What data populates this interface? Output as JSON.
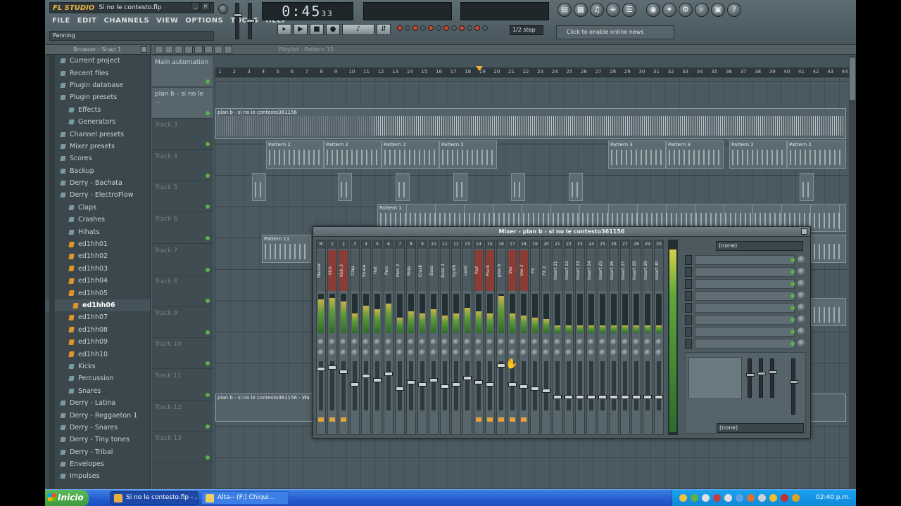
{
  "app": {
    "logo": "FL STUDIO",
    "window_title": "Si no le contesto.flp",
    "hint": "Panning",
    "time_display": "0:45",
    "time_ms": "33",
    "snap": "1/2 step",
    "news_text": "Click to enable online news",
    "menu": [
      "FILE",
      "EDIT",
      "CHANNELS",
      "VIEW",
      "OPTIONS",
      "TOOLS",
      "HELP"
    ]
  },
  "browser": {
    "title": "Browser - Snap 1",
    "items": [
      {
        "label": "Current project",
        "type": "folder",
        "level": 0
      },
      {
        "label": "Recent files",
        "type": "folder",
        "level": 0
      },
      {
        "label": "Plugin database",
        "type": "folder",
        "level": 0
      },
      {
        "label": "Plugin presets",
        "type": "folder",
        "level": 0
      },
      {
        "label": "Effects",
        "type": "folder",
        "level": 1
      },
      {
        "label": "Generators",
        "type": "folder",
        "level": 1
      },
      {
        "label": "Channel presets",
        "type": "folder",
        "level": 0
      },
      {
        "label": "Mixer presets",
        "type": "folder",
        "level": 0
      },
      {
        "label": "Scores",
        "type": "folder",
        "level": 0
      },
      {
        "label": "Backup",
        "type": "folder",
        "level": 0
      },
      {
        "label": "Derry - Bachata",
        "type": "folder",
        "level": 0
      },
      {
        "label": "Derry - ElectroFlow",
        "type": "folder",
        "level": 0
      },
      {
        "label": "Claps",
        "type": "folder",
        "level": 1
      },
      {
        "label": "Crashes",
        "type": "folder",
        "level": 1
      },
      {
        "label": "Hihats",
        "type": "folder",
        "level": 1
      },
      {
        "label": "ed1hh01",
        "type": "file",
        "level": 2
      },
      {
        "label": "ed1hh02",
        "type": "file",
        "level": 2
      },
      {
        "label": "ed1hh03",
        "type": "file",
        "level": 2
      },
      {
        "label": "ed1hh04",
        "type": "file",
        "level": 2
      },
      {
        "label": "ed1hh05",
        "type": "file",
        "level": 2
      },
      {
        "label": "ed1hh06",
        "type": "file",
        "level": 2,
        "selected": true
      },
      {
        "label": "ed1hh07",
        "type": "file",
        "level": 2
      },
      {
        "label": "ed1hh08",
        "type": "file",
        "level": 2
      },
      {
        "label": "ed1hh09",
        "type": "file",
        "level": 2
      },
      {
        "label": "ed1hh10",
        "type": "file",
        "level": 2
      },
      {
        "label": "Kicks",
        "type": "folder",
        "level": 1
      },
      {
        "label": "Percussion",
        "type": "folder",
        "level": 1
      },
      {
        "label": "Snares",
        "type": "folder",
        "level": 1
      },
      {
        "label": "Derry - Latina",
        "type": "folder",
        "level": 0
      },
      {
        "label": "Derry - Reggaeton 1",
        "type": "folder",
        "level": 0
      },
      {
        "label": "Derry - Snares",
        "type": "folder",
        "level": 0
      },
      {
        "label": "Derry - Tiny tones",
        "type": "folder",
        "level": 0
      },
      {
        "label": "Derry - Tribal",
        "type": "folder",
        "level": 0
      },
      {
        "label": "Envelopes",
        "type": "folder",
        "level": 0
      },
      {
        "label": "Impulses",
        "type": "folder",
        "level": 0
      }
    ]
  },
  "playlist": {
    "title": "Playlist - Pattern 15",
    "tracks": [
      "Main automation",
      "plan b - si no le ...",
      "Track 3",
      "Track 4",
      "Track 5",
      "Track 6",
      "Track 7",
      "Track 8",
      "Track 9",
      "Track 10",
      "Track 11",
      "Track 12",
      "Track 13"
    ],
    "ruler": [
      "1",
      "2",
      "3",
      "4",
      "5",
      "6",
      "7",
      "8",
      "9",
      "10",
      "11",
      "12",
      "13",
      "14",
      "15",
      "16",
      "17",
      "18",
      "19",
      "20",
      "21",
      "22",
      "23",
      "24",
      "25",
      "26",
      "27",
      "28",
      "29",
      "30",
      "31",
      "32",
      "33",
      "34",
      "35",
      "36",
      "37",
      "38",
      "39",
      "40",
      "41",
      "42",
      "43",
      "44"
    ],
    "audio_clip_label": "plan b - si no le contesto361156",
    "pattern_labels": [
      "Pattern 2",
      "Pattern 3",
      "Pattern 11",
      "Pattern 1"
    ],
    "bottom_clip_label": "plan b - si no le contesto361156 - Wa"
  },
  "mixer": {
    "title": "Mixer - plan b - si no le contesto361156",
    "strips": [
      {
        "num": "M",
        "label": "Master",
        "red": false,
        "level": 0.86
      },
      {
        "num": "1",
        "label": "Kick",
        "red": true,
        "level": 0.9
      },
      {
        "num": "2",
        "label": "Kick 2",
        "red": true,
        "level": 0.8
      },
      {
        "num": "3",
        "label": "Clap",
        "red": false,
        "level": 0.5
      },
      {
        "num": "4",
        "label": "Snare",
        "red": false,
        "level": 0.7
      },
      {
        "num": "5",
        "label": "Hat",
        "red": false,
        "level": 0.6
      },
      {
        "num": "6",
        "label": "Perc",
        "red": false,
        "level": 0.75
      },
      {
        "num": "7",
        "label": "Perc 2",
        "red": false,
        "level": 0.4
      },
      {
        "num": "8",
        "label": "Ride",
        "red": false,
        "level": 0.55
      },
      {
        "num": "9",
        "label": "Crash",
        "red": false,
        "level": 0.5
      },
      {
        "num": "10",
        "label": "Bass",
        "red": false,
        "level": 0.6
      },
      {
        "num": "11",
        "label": "Bass 2",
        "red": false,
        "level": 0.45
      },
      {
        "num": "12",
        "label": "Synth",
        "red": false,
        "level": 0.5
      },
      {
        "num": "13",
        "label": "Lead",
        "red": false,
        "level": 0.65
      },
      {
        "num": "14",
        "label": "Pad",
        "red": true,
        "level": 0.55
      },
      {
        "num": "15",
        "label": "Pluck",
        "red": true,
        "level": 0.5
      },
      {
        "num": "16",
        "label": "plan b",
        "red": false,
        "level": 0.95
      },
      {
        "num": "17",
        "label": "Vox",
        "red": true,
        "level": 0.5
      },
      {
        "num": "18",
        "label": "Vox 2",
        "red": true,
        "level": 0.45
      },
      {
        "num": "19",
        "label": "FX",
        "red": false,
        "level": 0.4
      },
      {
        "num": "20",
        "label": "FX 2",
        "red": false,
        "level": 0.35
      },
      {
        "num": "21",
        "label": "Insert 21",
        "red": false,
        "level": 0.2
      },
      {
        "num": "22",
        "label": "Insert 22",
        "red": false,
        "level": 0.2
      },
      {
        "num": "23",
        "label": "Insert 23",
        "red": false,
        "level": 0.2
      },
      {
        "num": "24",
        "label": "Insert 24",
        "red": false,
        "level": 0.2
      },
      {
        "num": "25",
        "label": "Insert 25",
        "red": false,
        "level": 0.2
      },
      {
        "num": "26",
        "label": "Insert 26",
        "red": false,
        "level": 0.2
      },
      {
        "num": "27",
        "label": "Insert 27",
        "red": false,
        "level": 0.2
      },
      {
        "num": "28",
        "label": "Insert 28",
        "red": false,
        "level": 0.2
      },
      {
        "num": "29",
        "label": "Insert 29",
        "red": false,
        "level": 0.2
      },
      {
        "num": "30",
        "label": "Insert 30",
        "red": false,
        "level": 0.2
      }
    ],
    "input_label": "(none)",
    "output_label": "(none)"
  },
  "taskbar": {
    "start": "Inicio",
    "tasks": [
      "Si no le contesto.flp - ...",
      "Alta-- (F:) Chiqui..."
    ],
    "clock": "02:40 p.m."
  },
  "colors": {
    "accent_orange": "#e9a23a",
    "meter_green": "#5fa83a",
    "channel_red": "#8a3d37",
    "xp_blue": "#245bd0"
  }
}
